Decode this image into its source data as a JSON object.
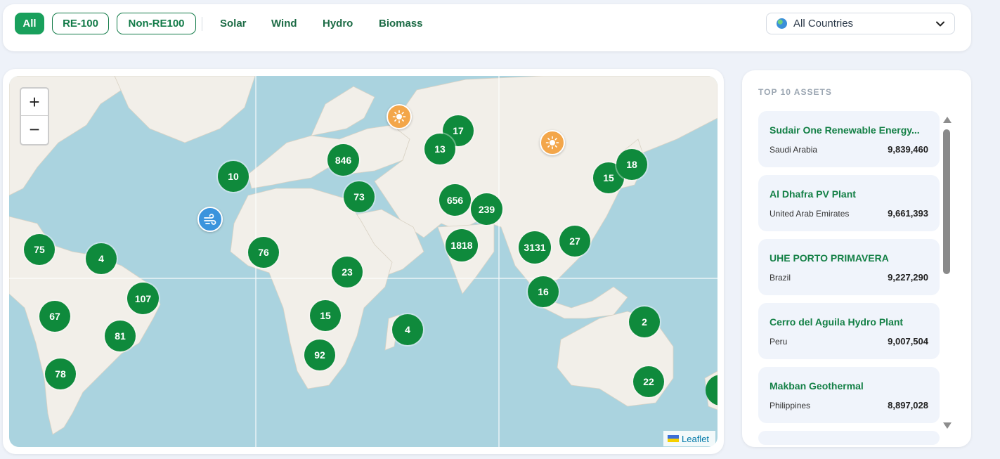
{
  "filters": {
    "all": "All",
    "re100": "RE-100",
    "non_re100": "Non-RE100",
    "types": [
      "Solar",
      "Wind",
      "Hydro",
      "Biomass"
    ]
  },
  "country_select": {
    "value": "All Countries"
  },
  "map": {
    "zoom_in": "+",
    "zoom_out": "−",
    "attribution": "Leaflet",
    "clusters": [
      "10",
      "846",
      "17",
      "13",
      "73",
      "656",
      "239",
      "15",
      "18",
      "75",
      "4",
      "76",
      "23",
      "1818",
      "3131",
      "27",
      "107",
      "67",
      "81",
      "15",
      "4",
      "16",
      "2",
      "92",
      "78",
      "22"
    ],
    "asset_markers": [
      "solar",
      "solar",
      "wind"
    ]
  },
  "top_assets": {
    "title": "TOP 10 ASSETS",
    "items": [
      {
        "name": "Sudair One Renewable Energy...",
        "country": "Saudi Arabia",
        "value": "9,839,460"
      },
      {
        "name": "Al Dhafra PV Plant",
        "country": "United Arab Emirates",
        "value": "9,661,393"
      },
      {
        "name": "UHE PORTO PRIMAVERA",
        "country": "Brazil",
        "value": "9,227,290"
      },
      {
        "name": "Cerro del Aguila Hydro Plant",
        "country": "Peru",
        "value": "9,007,504"
      },
      {
        "name": "Makban Geothermal",
        "country": "Philippines",
        "value": "8,897,028"
      }
    ]
  },
  "colors": {
    "accent": "#19a05c",
    "cluster": "#0f8a3c",
    "solar": "#f3a64a",
    "wind": "#3b94dd",
    "water": "#aad3df",
    "land": "#f2efe9"
  }
}
